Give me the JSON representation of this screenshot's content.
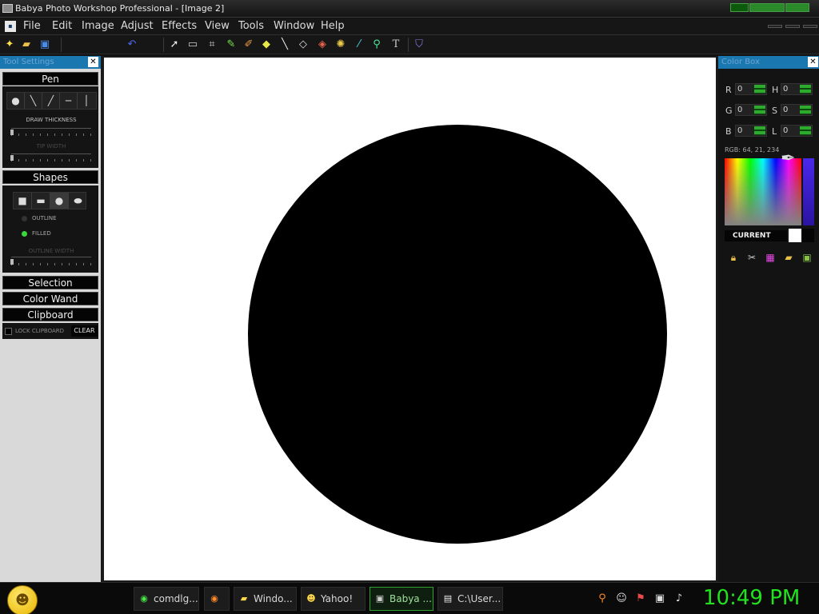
{
  "window": {
    "title": "Babya Photo Workshop Professional - [Image  2]"
  },
  "menu": {
    "items": [
      "File",
      "Edit",
      "Image",
      "Adjust",
      "Effects",
      "View",
      "Tools",
      "Window",
      "Help"
    ]
  },
  "toolbar": {
    "icons": [
      "new-icon",
      "open-icon",
      "save-icon",
      "undo-icon",
      "pointer-icon",
      "rect-select-icon",
      "crop-icon",
      "pen-icon",
      "brush-icon",
      "eraser-icon",
      "line-icon",
      "fill-icon",
      "paint-bucket-icon",
      "shape-icon",
      "eyedropper-icon",
      "magnifier-icon",
      "text-icon",
      "stamp-icon"
    ]
  },
  "tool_settings": {
    "header": "Tool Settings",
    "pen_label": "Pen",
    "draw_thickness_label": "DRAW THICKNESS",
    "tip_width_label": "TIP WIDTH",
    "shapes_label": "Shapes",
    "outline_label": "OUTLINE",
    "filled_label": "FILLED",
    "outline_width_label": "OUTLINE WIDTH",
    "selection_label": "Selection",
    "color_wand_label": "Color Wand",
    "clipboard_label": "Clipboard",
    "lock_clipboard_label": "LOCK CLIPBOARD",
    "clear_label": "CLEAR",
    "selected_shape_fill": "filled"
  },
  "color_box": {
    "header": "Color Box",
    "r_label": "R",
    "g_label": "G",
    "b_label": "B",
    "h_label": "H",
    "s_label": "S",
    "l_label": "L",
    "r_value": "0",
    "g_value": "0",
    "b_value": "0",
    "h_value": "0",
    "s_value": "0",
    "l_value": "0",
    "rgb_text": "RGB: 64, 21, 234",
    "current_label": "CURRENT"
  },
  "taskbar": {
    "tasks": [
      {
        "label": "comdlg...",
        "icon": "chrome-icon"
      },
      {
        "label": "",
        "icon": "firefox-icon"
      },
      {
        "label": "Windo...",
        "icon": "folder-icon"
      },
      {
        "label": "Yahoo! ...",
        "icon": "yahoo-icon"
      },
      {
        "label": "Babya ...",
        "icon": "babya-icon"
      },
      {
        "label": "C:\\User...",
        "icon": "archive-icon"
      }
    ],
    "clock": "10:49 PM"
  },
  "colors": {
    "accent_green": "#22e11e",
    "panel_header_blue": "#1b77b0"
  }
}
